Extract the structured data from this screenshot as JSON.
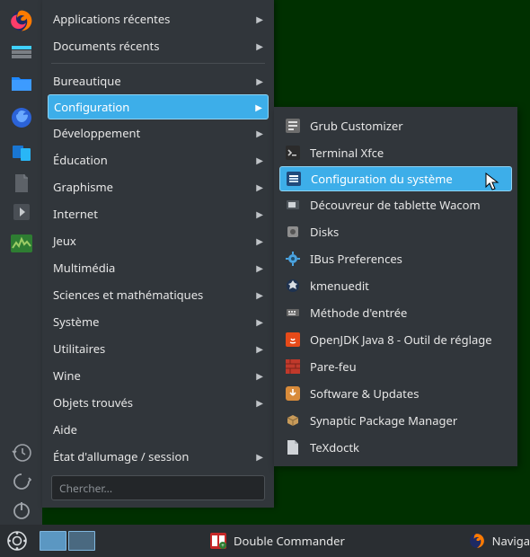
{
  "launcher_icons": [
    "firefox",
    "activity",
    "files",
    "waterfox",
    "kde-connect",
    "doc",
    "forward",
    "monitor"
  ],
  "launcher_bottom": [
    "clock-back",
    "refresh",
    "power"
  ],
  "menu": {
    "pinned": [
      {
        "label": "Applications récentes",
        "arrow": true
      },
      {
        "label": "Documents récents",
        "arrow": true
      }
    ],
    "cats": [
      {
        "label": "Bureautique",
        "arrow": true,
        "sel": false
      },
      {
        "label": "Configuration",
        "arrow": true,
        "sel": true
      },
      {
        "label": "Développement",
        "arrow": true,
        "sel": false
      },
      {
        "label": "Éducation",
        "arrow": true,
        "sel": false
      },
      {
        "label": "Graphisme",
        "arrow": true,
        "sel": false
      },
      {
        "label": "Internet",
        "arrow": true,
        "sel": false
      },
      {
        "label": "Jeux",
        "arrow": true,
        "sel": false
      },
      {
        "label": "Multimédia",
        "arrow": true,
        "sel": false
      },
      {
        "label": "Sciences et mathématiques",
        "arrow": true,
        "sel": false
      },
      {
        "label": "Système",
        "arrow": true,
        "sel": false
      },
      {
        "label": "Utilitaires",
        "arrow": true,
        "sel": false
      },
      {
        "label": "Wine",
        "arrow": true,
        "sel": false
      },
      {
        "label": "Objets trouvés",
        "arrow": true,
        "sel": false
      },
      {
        "label": "Aide",
        "arrow": false,
        "sel": false
      },
      {
        "label": "État d'allumage / session",
        "arrow": true,
        "sel": false
      }
    ],
    "search_placeholder": "Chercher..."
  },
  "submenu": [
    {
      "icon": "grub",
      "label": "Grub Customizer",
      "sel": false
    },
    {
      "icon": "terminal",
      "label": "Terminal Xfce",
      "sel": false
    },
    {
      "icon": "settings",
      "label": "Configuration du système",
      "sel": true
    },
    {
      "icon": "tablet",
      "label": "Découvreur de tablette Wacom",
      "sel": false
    },
    {
      "icon": "disks",
      "label": "Disks",
      "sel": false
    },
    {
      "icon": "ibus",
      "label": "IBus Preferences",
      "sel": false
    },
    {
      "icon": "kmenu",
      "label": "kmenuedit",
      "sel": false
    },
    {
      "icon": "input",
      "label": "Méthode d'entrée",
      "sel": false
    },
    {
      "icon": "java",
      "label": "OpenJDK Java 8 - Outil de réglage",
      "sel": false
    },
    {
      "icon": "firewall",
      "label": "Pare-feu",
      "sel": false
    },
    {
      "icon": "updates",
      "label": "Software & Updates",
      "sel": false
    },
    {
      "icon": "synaptic",
      "label": "Synaptic Package Manager",
      "sel": false
    },
    {
      "icon": "tex",
      "label": "TeXdoctk",
      "sel": false
    }
  ],
  "panel": {
    "task1": "Double Commander",
    "task2": "Naviga"
  }
}
